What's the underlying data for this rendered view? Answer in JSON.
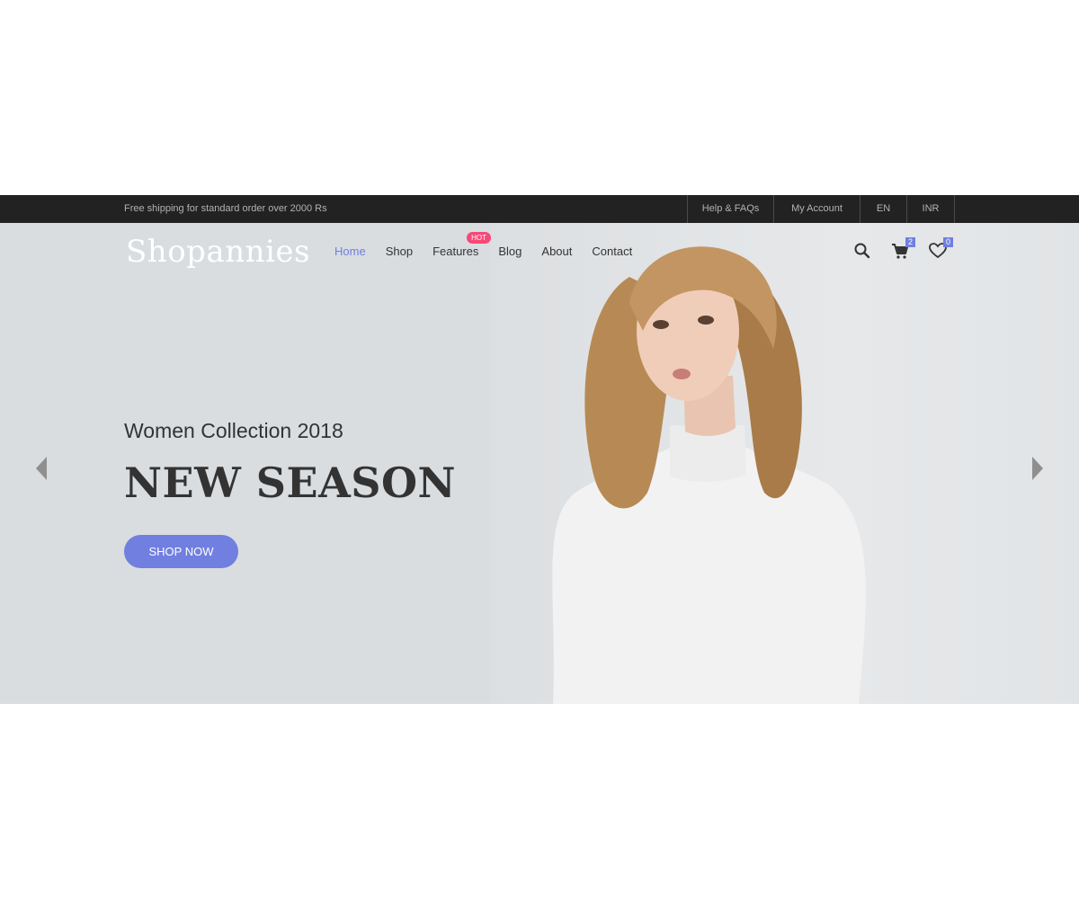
{
  "topbar": {
    "shipping_text": "Free shipping for standard order over 2000 Rs",
    "links": [
      "Help & FAQs",
      "My Account",
      "EN",
      "INR"
    ]
  },
  "header": {
    "logo": "Shopannies",
    "nav": [
      {
        "label": "Home",
        "active": true
      },
      {
        "label": "Shop"
      },
      {
        "label": "Features",
        "badge": "HOT"
      },
      {
        "label": "Blog"
      },
      {
        "label": "About"
      },
      {
        "label": "Contact"
      }
    ],
    "icons": {
      "search": "search-icon",
      "cart": "cart-icon",
      "wishlist": "heart-icon"
    },
    "cart_count": "2",
    "wishlist_count": "0"
  },
  "hero": {
    "subtitle": "Women Collection 2018",
    "headline": "NEW SEASON",
    "cta_label": "SHOP NOW"
  },
  "colors": {
    "accent": "#717fe0",
    "hot_badge": "#f74877",
    "topbar_bg": "#222222",
    "hero_bg": "#d9dde0"
  }
}
